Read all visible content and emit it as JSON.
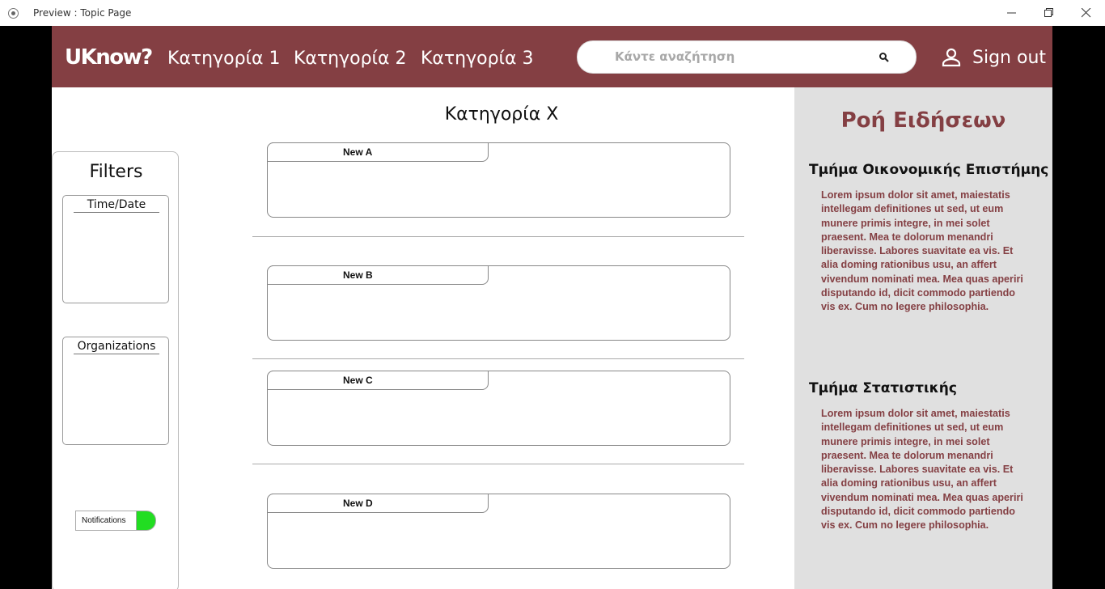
{
  "window": {
    "title": "Preview : Topic Page"
  },
  "navbar": {
    "logo": "UKnow?",
    "links": [
      "Κατηγορία 1",
      "Κατηγορία 2",
      "Κατηγορία 3"
    ],
    "search_placeholder": "Κάντε αναζήτηση",
    "signout_label": "Sign out",
    "bg_color": "#843f43"
  },
  "filters": {
    "title": "Filters",
    "boxes": [
      "Time/Date",
      "Organizations"
    ],
    "notifications_label": "Notifications",
    "notifications_on": true,
    "toggle_color": "#22dd22"
  },
  "main": {
    "title": "Κατηγορία Χ",
    "cards": [
      {
        "title": "New A"
      },
      {
        "title": "New B"
      },
      {
        "title": "New C"
      },
      {
        "title": "New D"
      }
    ]
  },
  "news_feed": {
    "title": "Ροή Ειδήσεων",
    "sections": [
      {
        "title": "Τμήμα Οικονομικής Επιστήμης",
        "text": "Lorem ipsum dolor sit amet, maiestatis intellegam definitiones ut sed, ut eum munere primis integre, in mei solet praesent. Mea te dolorum menandri liberavisse. Labores suavitate ea vis. Et alia doming rationibus usu, an affert vivendum nominati mea. Mea quas aperiri disputando id, dicit commodo partiendo vis ex. Cum no legere philosophia."
      },
      {
        "title": "Τμήμα Στατιστικής",
        "text": "Lorem ipsum dolor sit amet, maiestatis intellegam definitiones ut sed, ut eum munere primis integre, in mei solet praesent. Mea te dolorum menandri liberavisse. Labores suavitate ea vis. Et alia doming rationibus usu, an affert vivendum nominati mea. Mea quas aperiri disputando id, dicit commodo partiendo vis ex. Cum no legere philosophia."
      }
    ]
  }
}
